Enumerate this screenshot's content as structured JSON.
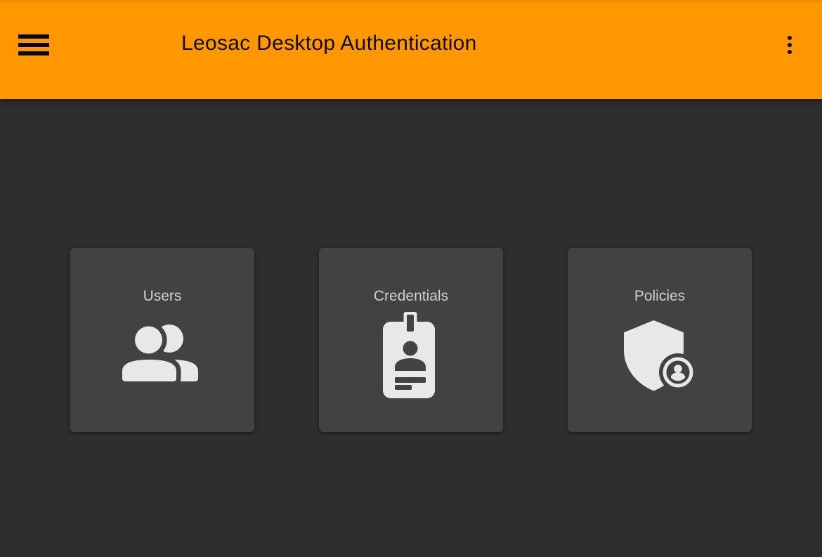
{
  "header": {
    "title": "Leosac Desktop Authentication",
    "menu_icon": "hamburger-icon",
    "overflow_icon": "kebab-menu-icon"
  },
  "cards": [
    {
      "id": "users",
      "label": "Users",
      "icon": "users-icon"
    },
    {
      "id": "credentials",
      "label": "Credentials",
      "icon": "id-badge-icon"
    },
    {
      "id": "policies",
      "label": "Policies",
      "icon": "shield-user-icon"
    }
  ],
  "colors": {
    "header_bg": "#ff9800",
    "header_text": "#0d0d0d",
    "page_bg": "#2e2e2e",
    "card_bg": "#424242",
    "card_label": "#cfcfcf",
    "icon_fill": "#e8e8e8"
  }
}
